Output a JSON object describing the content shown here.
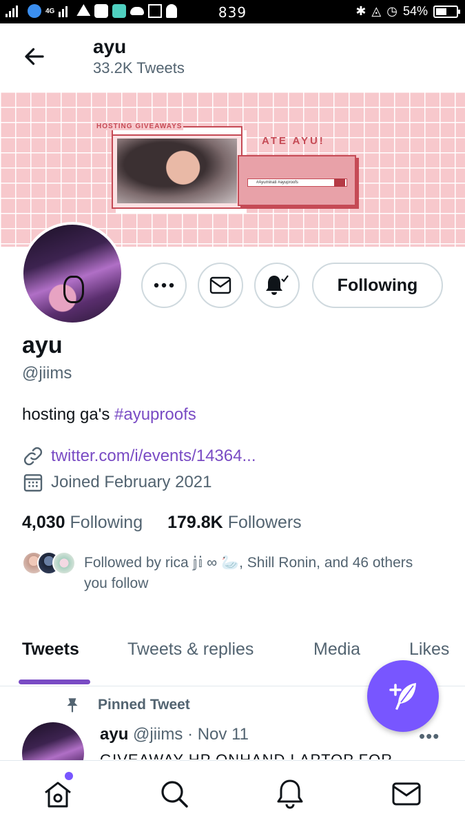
{
  "status_bar": {
    "network": "4G",
    "time": "839",
    "battery": "54%"
  },
  "header": {
    "name": "ayu",
    "tweet_count": "33.2K Tweets"
  },
  "banner": {
    "window_title": "HOSTING GIVEAWAYS",
    "headline": "ATE AYU!",
    "search_text": "#Ayuminati #ayuproofs"
  },
  "actions": {
    "following_label": "Following"
  },
  "profile": {
    "name": "ayu",
    "handle": "@jiims",
    "bio_text": "hosting ga's ",
    "bio_hashtag": "#ayuproofs",
    "link": "twitter.com/i/events/14364...",
    "joined": "Joined February 2021",
    "following_count": "4,030",
    "following_label": "Following",
    "followers_count": "179.8K",
    "followers_label": "Followers",
    "followed_by": "Followed by rica 𝕛𝕚 ∞ 🦢, Shill Ronin, and 46 others you follow"
  },
  "tabs": [
    {
      "label": "Tweets",
      "active": true
    },
    {
      "label": "Tweets & replies",
      "active": false
    },
    {
      "label": "Media",
      "active": false
    },
    {
      "label": "Likes",
      "active": false
    }
  ],
  "pinned_tweet": {
    "pinned_label": "Pinned Tweet",
    "author": "ayu",
    "handle": "@jiims",
    "date": "· Nov 11",
    "text": "GIVEAWAY HP ONHAND LAPTOP FOR",
    "more": "•••"
  },
  "colors": {
    "accent": "#794bc4",
    "fab": "#7856ff",
    "secondary_text": "#536471"
  },
  "icons": {
    "back": "arrow-left-icon",
    "more": "more-icon",
    "message": "mail-icon",
    "notify": "bell-check-icon",
    "link": "link-icon",
    "calendar": "calendar-icon",
    "pin": "pin-icon",
    "compose": "feather-plus-icon",
    "nav": [
      "home-icon",
      "search-icon",
      "bell-icon",
      "mail-icon"
    ]
  }
}
